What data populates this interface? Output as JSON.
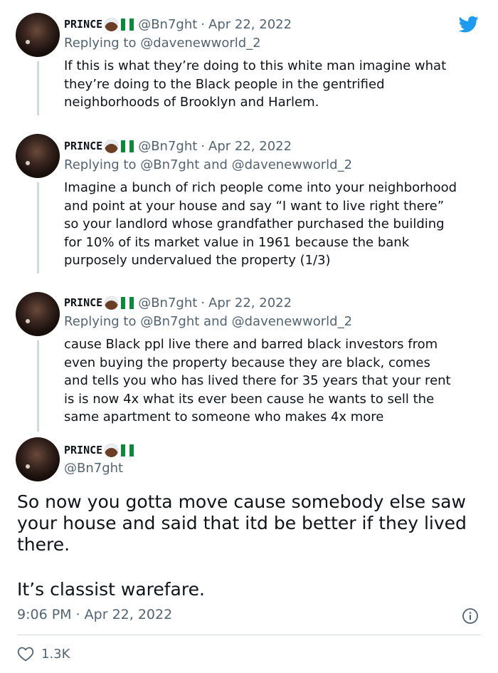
{
  "author": {
    "name": "PRINCE",
    "handle": "@Bn7ght"
  },
  "tweets": [
    {
      "date": "Apr 22, 2022",
      "replying_to_label": "Replying to",
      "replying_to": "@davenewworld_2",
      "text_lines": [
        "If this is what they’re doing to this white man imagine what",
        "they’re doing to the Black people in the gentrified",
        "neighborhoods of Brooklyn and Harlem."
      ]
    },
    {
      "date": "Apr 22, 2022",
      "replying_to_label": "Replying to",
      "replying_to": "@Bn7ght and @davenewworld_2",
      "text_lines": [
        "Imagine a bunch of rich people come into your neighborhood",
        "and point at your house and say “I want to live right there”",
        "so your landlord whose grandfather purchased the building",
        "for 10% of its market value in 1961 because the bank",
        "purposely undervalued the property (1/3)"
      ]
    },
    {
      "date": "Apr 22, 2022",
      "replying_to_label": "Replying to",
      "replying_to": "@Bn7ght and @davenewworld_2",
      "text_lines": [
        "cause Black ppl live there and barred black investors from",
        "even buying the property because they are black, comes",
        "and tells you who has lived there for 35 years that your rent",
        "is is now 4x what its ever been cause he wants to sell the",
        "same apartment to someone who makes 4x more"
      ]
    }
  ],
  "main_tweet": {
    "text_lines": [
      "So now you gotta move cause somebody else saw",
      "your house and said that itd be better if they lived",
      "there."
    ],
    "text_line_2": "It’s classist warefare.",
    "timestamp": "9:06 PM · Apr 22, 2022",
    "likes": "1.3K"
  },
  "separator": "·",
  "icons": {
    "brand": "twitter-bird-icon",
    "info": "info-icon",
    "like": "heart-icon"
  },
  "colors": {
    "twitter_blue": "#1d9bf0",
    "secondary_text": "#536471",
    "thread_line": "#cfd9de",
    "nigeria_green": "#0a8a3a"
  }
}
